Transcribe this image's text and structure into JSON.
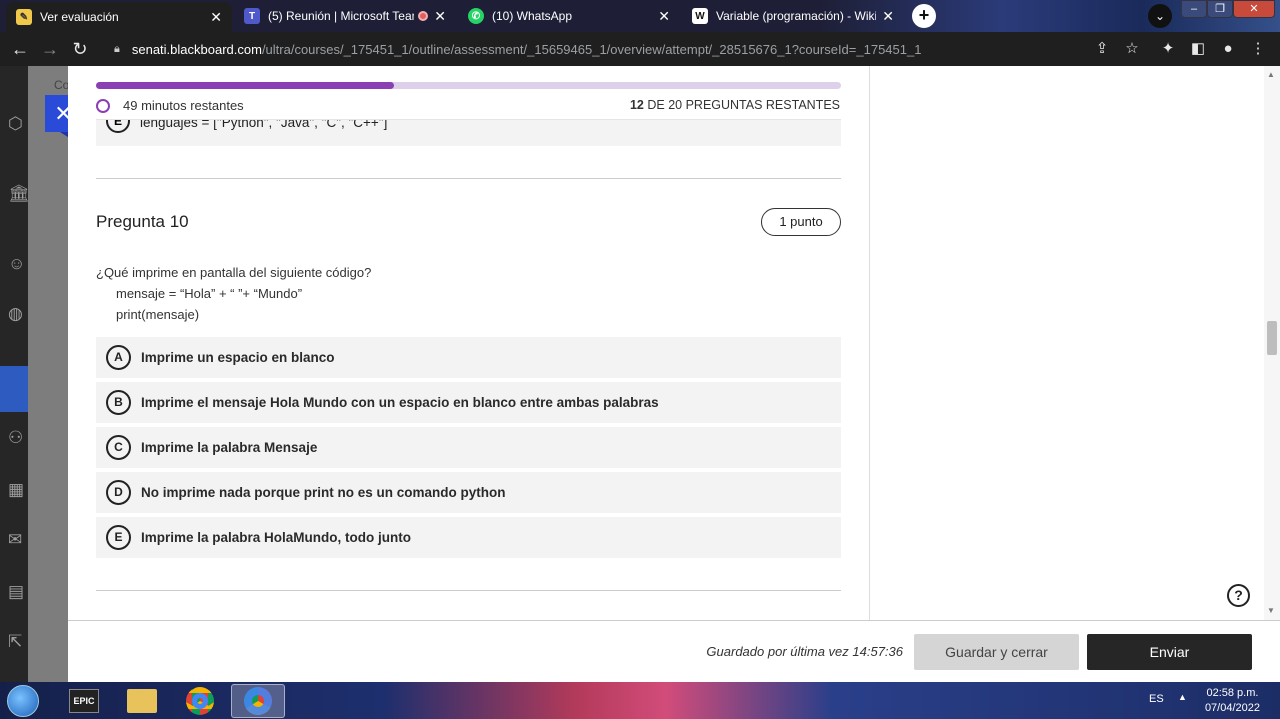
{
  "browser": {
    "tabs": [
      {
        "title": "Ver evaluación",
        "active": true
      },
      {
        "title": "(5) Reunión | Microsoft Teams",
        "active": false
      },
      {
        "title": "(10) WhatsApp",
        "active": false
      },
      {
        "title": "Variable (programación) - Wikipedia",
        "active": false
      }
    ],
    "url_host": "senati.blackboard.com",
    "url_path": "/ultra/courses/_175451_1/outline/assessment/_15659465_1/overview/attempt/_28515676_1?courseId=_175451_1"
  },
  "overlay_text": "Co",
  "assessment": {
    "progress_fraction": 0.4,
    "time_remaining": "49 minutos restantes",
    "questions_remaining_count": "12",
    "questions_remaining_text": "DE 20 PREGUNTAS RESTANTES",
    "previous_option": {
      "letter": "E",
      "text": "lenguajes = [\"Python\", \"Java\", \"C\", \"C++\"]"
    },
    "question": {
      "title": "Pregunta 10",
      "points": "1 punto",
      "prompt": "¿Qué imprime en pantalla del siguiente código?",
      "code_line_1": "mensaje = “Hola” + “ ”+ “Mundo”",
      "code_line_2": "print(mensaje)",
      "options": [
        {
          "letter": "A",
          "text": "Imprime un espacio en blanco"
        },
        {
          "letter": "B",
          "text": "Imprime el mensaje Hola Mundo con un espacio en blanco entre ambas palabras"
        },
        {
          "letter": "C",
          "text": "Imprime la palabra Mensaje"
        },
        {
          "letter": "D",
          "text": "No imprime nada porque print no es un comando python"
        },
        {
          "letter": "E",
          "text": "Imprime la palabra HolaMundo, todo junto"
        }
      ]
    }
  },
  "footer": {
    "saved_text": "Guardado por última vez 14:57:36",
    "save_close_label": "Guardar y cerrar",
    "submit_label": "Enviar"
  },
  "taskbar": {
    "language": "ES",
    "time": "02:58 p.m.",
    "date": "07/04/2022",
    "epic_label": "EPIC"
  },
  "colors": {
    "accent_purple": "#8b3fb5",
    "close_blue": "#2a4bd8"
  }
}
